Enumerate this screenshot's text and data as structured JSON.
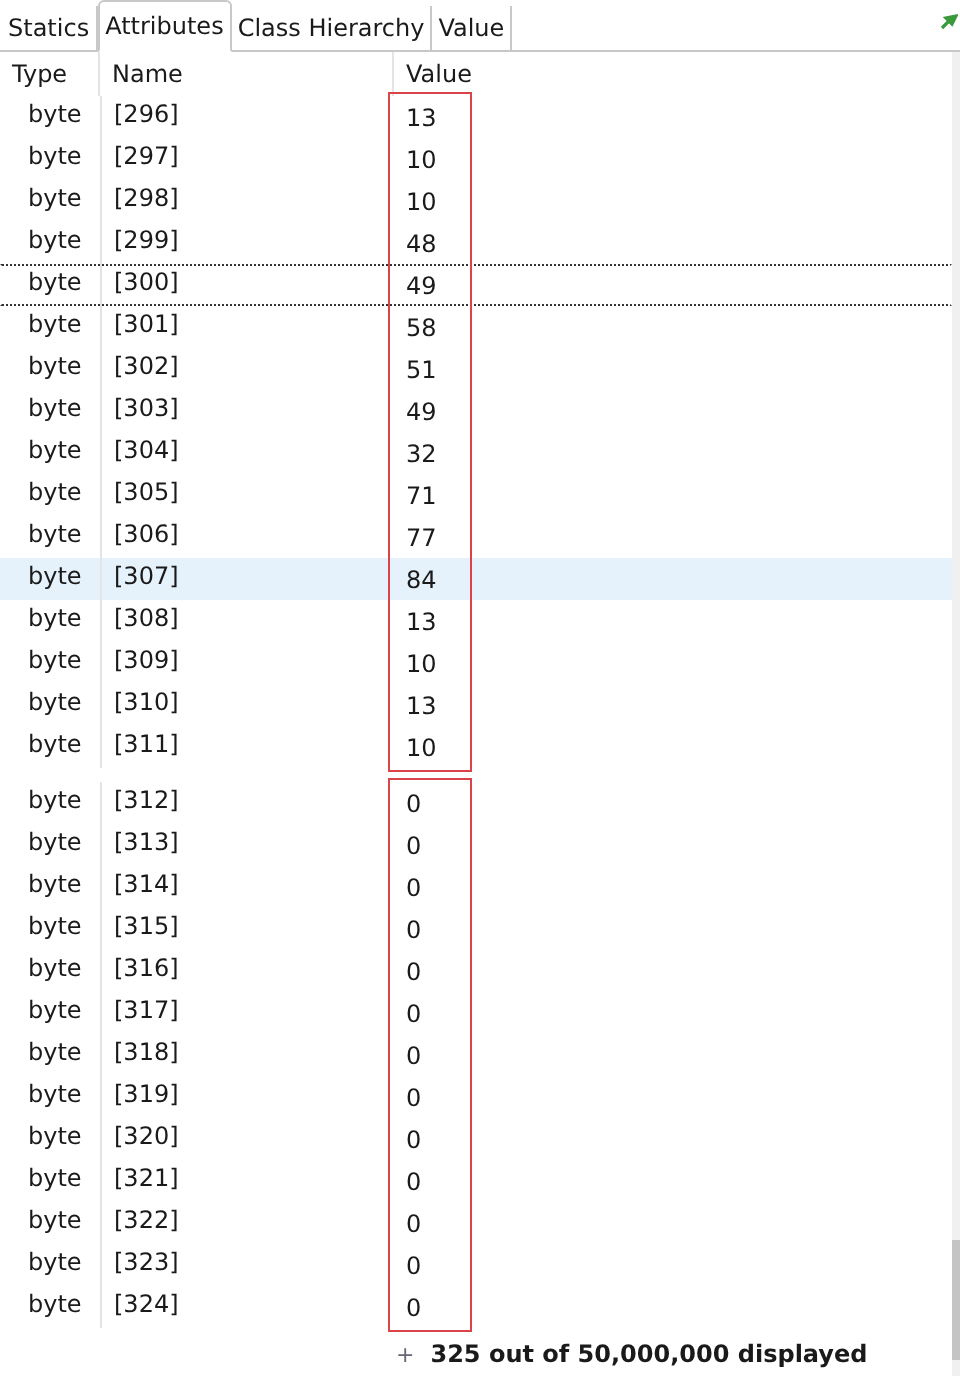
{
  "tabs": [
    {
      "label": "Statics",
      "selected": false
    },
    {
      "label": "Attributes",
      "selected": true
    },
    {
      "label": "Class Hierarchy",
      "selected": false
    },
    {
      "label": "Value",
      "selected": false
    }
  ],
  "table": {
    "columns": [
      "Type",
      "Name",
      "Value"
    ],
    "blocks": [
      {
        "rows": [
          {
            "type": "byte",
            "name": "[296]",
            "value": "13",
            "selected": false,
            "focused": false
          },
          {
            "type": "byte",
            "name": "[297]",
            "value": "10",
            "selected": false,
            "focused": false
          },
          {
            "type": "byte",
            "name": "[298]",
            "value": "10",
            "selected": false,
            "focused": false
          },
          {
            "type": "byte",
            "name": "[299]",
            "value": "48",
            "selected": false,
            "focused": false
          },
          {
            "type": "byte",
            "name": "[300]",
            "value": "49",
            "selected": false,
            "focused": true
          },
          {
            "type": "byte",
            "name": "[301]",
            "value": "58",
            "selected": false,
            "focused": false
          },
          {
            "type": "byte",
            "name": "[302]",
            "value": "51",
            "selected": false,
            "focused": false
          },
          {
            "type": "byte",
            "name": "[303]",
            "value": "49",
            "selected": false,
            "focused": false
          },
          {
            "type": "byte",
            "name": "[304]",
            "value": "32",
            "selected": false,
            "focused": false
          },
          {
            "type": "byte",
            "name": "[305]",
            "value": "71",
            "selected": false,
            "focused": false
          },
          {
            "type": "byte",
            "name": "[306]",
            "value": "77",
            "selected": false,
            "focused": false
          },
          {
            "type": "byte",
            "name": "[307]",
            "value": "84",
            "selected": true,
            "focused": false
          },
          {
            "type": "byte",
            "name": "[308]",
            "value": "13",
            "selected": false,
            "focused": false
          },
          {
            "type": "byte",
            "name": "[309]",
            "value": "10",
            "selected": false,
            "focused": false
          },
          {
            "type": "byte",
            "name": "[310]",
            "value": "13",
            "selected": false,
            "focused": false
          },
          {
            "type": "byte",
            "name": "[311]",
            "value": "10",
            "selected": false,
            "focused": false
          }
        ]
      },
      {
        "rows": [
          {
            "type": "byte",
            "name": "[312]",
            "value": "0",
            "selected": false,
            "focused": false
          },
          {
            "type": "byte",
            "name": "[313]",
            "value": "0",
            "selected": false,
            "focused": false
          },
          {
            "type": "byte",
            "name": "[314]",
            "value": "0",
            "selected": false,
            "focused": false
          },
          {
            "type": "byte",
            "name": "[315]",
            "value": "0",
            "selected": false,
            "focused": false
          },
          {
            "type": "byte",
            "name": "[316]",
            "value": "0",
            "selected": false,
            "focused": false
          },
          {
            "type": "byte",
            "name": "[317]",
            "value": "0",
            "selected": false,
            "focused": false
          },
          {
            "type": "byte",
            "name": "[318]",
            "value": "0",
            "selected": false,
            "focused": false
          },
          {
            "type": "byte",
            "name": "[319]",
            "value": "0",
            "selected": false,
            "focused": false
          },
          {
            "type": "byte",
            "name": "[320]",
            "value": "0",
            "selected": false,
            "focused": false
          },
          {
            "type": "byte",
            "name": "[321]",
            "value": "0",
            "selected": false,
            "focused": false
          },
          {
            "type": "byte",
            "name": "[322]",
            "value": "0",
            "selected": false,
            "focused": false
          },
          {
            "type": "byte",
            "name": "[323]",
            "value": "0",
            "selected": false,
            "focused": false
          },
          {
            "type": "byte",
            "name": "[324]",
            "value": "0",
            "selected": false,
            "focused": false
          }
        ]
      }
    ],
    "footer": {
      "expander": "+",
      "text": "325 out of 50,000,000 displayed"
    }
  }
}
